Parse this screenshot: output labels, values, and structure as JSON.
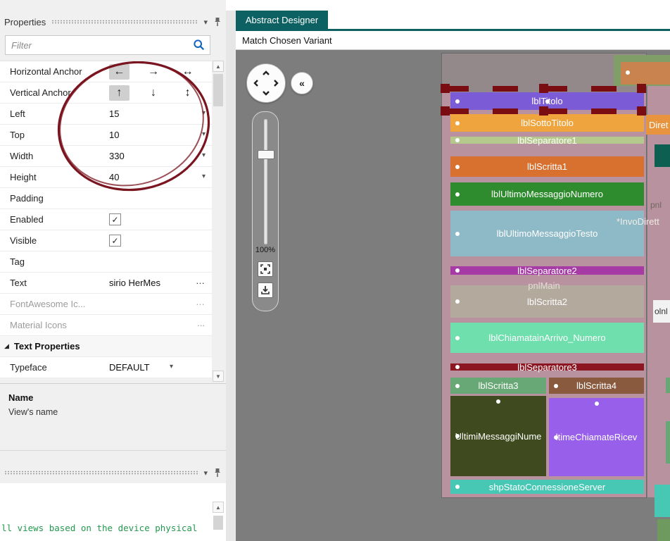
{
  "colors": {
    "accent_teal": "#0d6163",
    "annotation_red": "#7a1520",
    "canvas_gray": "#7d7d7d",
    "selection_red": "#7a0d12",
    "output_green": "#22994f",
    "search_blue": "#1565c0"
  },
  "icons": {
    "dropdown_arrow": "▾",
    "chevron_down": "▾",
    "scroll_up": "▲",
    "scroll_down": "▼",
    "collapse_left": "«",
    "section_expanded": "◢"
  },
  "properties_panel": {
    "title": "Properties",
    "filter_placeholder": "Filter",
    "checkmark": "✓",
    "rows": [
      {
        "label": "Horizontal Anchor",
        "type": "anchor",
        "buttons": [
          "←",
          "→",
          "↔"
        ],
        "selected_index": 0
      },
      {
        "label": "Vertical Anchor",
        "type": "anchor",
        "buttons": [
          "↑",
          "↓",
          "↕"
        ],
        "selected_index": 0
      },
      {
        "label": "Left",
        "type": "dropdown",
        "value": "15"
      },
      {
        "label": "Top",
        "type": "dropdown",
        "value": "10"
      },
      {
        "label": "Width",
        "type": "dropdown",
        "value": "330"
      },
      {
        "label": "Height",
        "type": "dropdown",
        "value": "40"
      },
      {
        "label": "Padding",
        "type": "text",
        "value": ""
      },
      {
        "label": "Enabled",
        "type": "checkbox",
        "checked": true
      },
      {
        "label": "Visible",
        "type": "checkbox",
        "checked": true
      },
      {
        "label": "Tag",
        "type": "text",
        "value": ""
      },
      {
        "label": "Text",
        "type": "ellipsis",
        "value": "sirio HerMes",
        "button": "…"
      },
      {
        "label": "FontAwesome Ic...",
        "type": "ellipsis",
        "value": "",
        "button": "…",
        "disabled": true
      },
      {
        "label": "Material Icons",
        "type": "ellipsis",
        "value": "",
        "button": "...",
        "disabled": true
      },
      {
        "label": "Text Properties",
        "type": "section"
      },
      {
        "label": "Typeface",
        "type": "dropdown",
        "value": "DEFAULT"
      }
    ],
    "help": {
      "title": "Name",
      "text": "View's name"
    }
  },
  "designer": {
    "tab_label": "Abstract Designer",
    "variant_label": "Match Chosen Variant",
    "zoom_label": "100%",
    "pnl_main_label": "pnlMain",
    "labels": [
      {
        "text": "lblTitolo",
        "color": "#7c5cd6"
      },
      {
        "text": "lblSottoTitolo",
        "color": "#f0a43e"
      },
      {
        "text": "lblSeparatore1",
        "color": "#b5c98c"
      },
      {
        "text": "lblScritta1",
        "color": "#d8702f"
      },
      {
        "text": "lblUltimoMessaggioNumero",
        "color": "#2e8b2e"
      },
      {
        "text": "lblUltimoMessaggioTesto",
        "color": "#8ebac7"
      },
      {
        "text": "lblSeparatore2",
        "color": "#a63ba6"
      },
      {
        "text": "lblScritta2",
        "color": "#b3a99d"
      },
      {
        "text": "lblChiamatainArrivo_Numero",
        "color": "#6fdfae"
      },
      {
        "text": "lblSeparatore3",
        "color": "#8c1622"
      },
      {
        "text": "lblScritta3",
        "color": "#68a876"
      },
      {
        "text": "lblScritta4",
        "color": "#8a5a3e"
      },
      {
        "text": "UltimiMessaggiNume",
        "color": "#3f4a1f"
      },
      {
        "text": "ltimeChiamateRicev",
        "color": "#975fea"
      },
      {
        "text": "shpStatoConnessioneServer",
        "color": "#47c8b5"
      }
    ],
    "fragments": {
      "phone_bg": "#b8929e",
      "phone_top": "#93898a",
      "green_top": "#7f9e68",
      "orange_top": "#c8834e",
      "diret": {
        "text": "Diret",
        "color": "#e8943f"
      },
      "teal_block": "#0d5f52",
      "pnl_text": "pnl",
      "invo_text": "*InvoDirett",
      "white_box": {
        "text": "olnl",
        "color": "#f2f2f2"
      },
      "green_edge": "#68a876",
      "turquoise_bottom": "#47c8b5",
      "green_bottom": "#6f9a5f"
    }
  },
  "output_panel": {
    "line": "ll views based on the device physical"
  }
}
